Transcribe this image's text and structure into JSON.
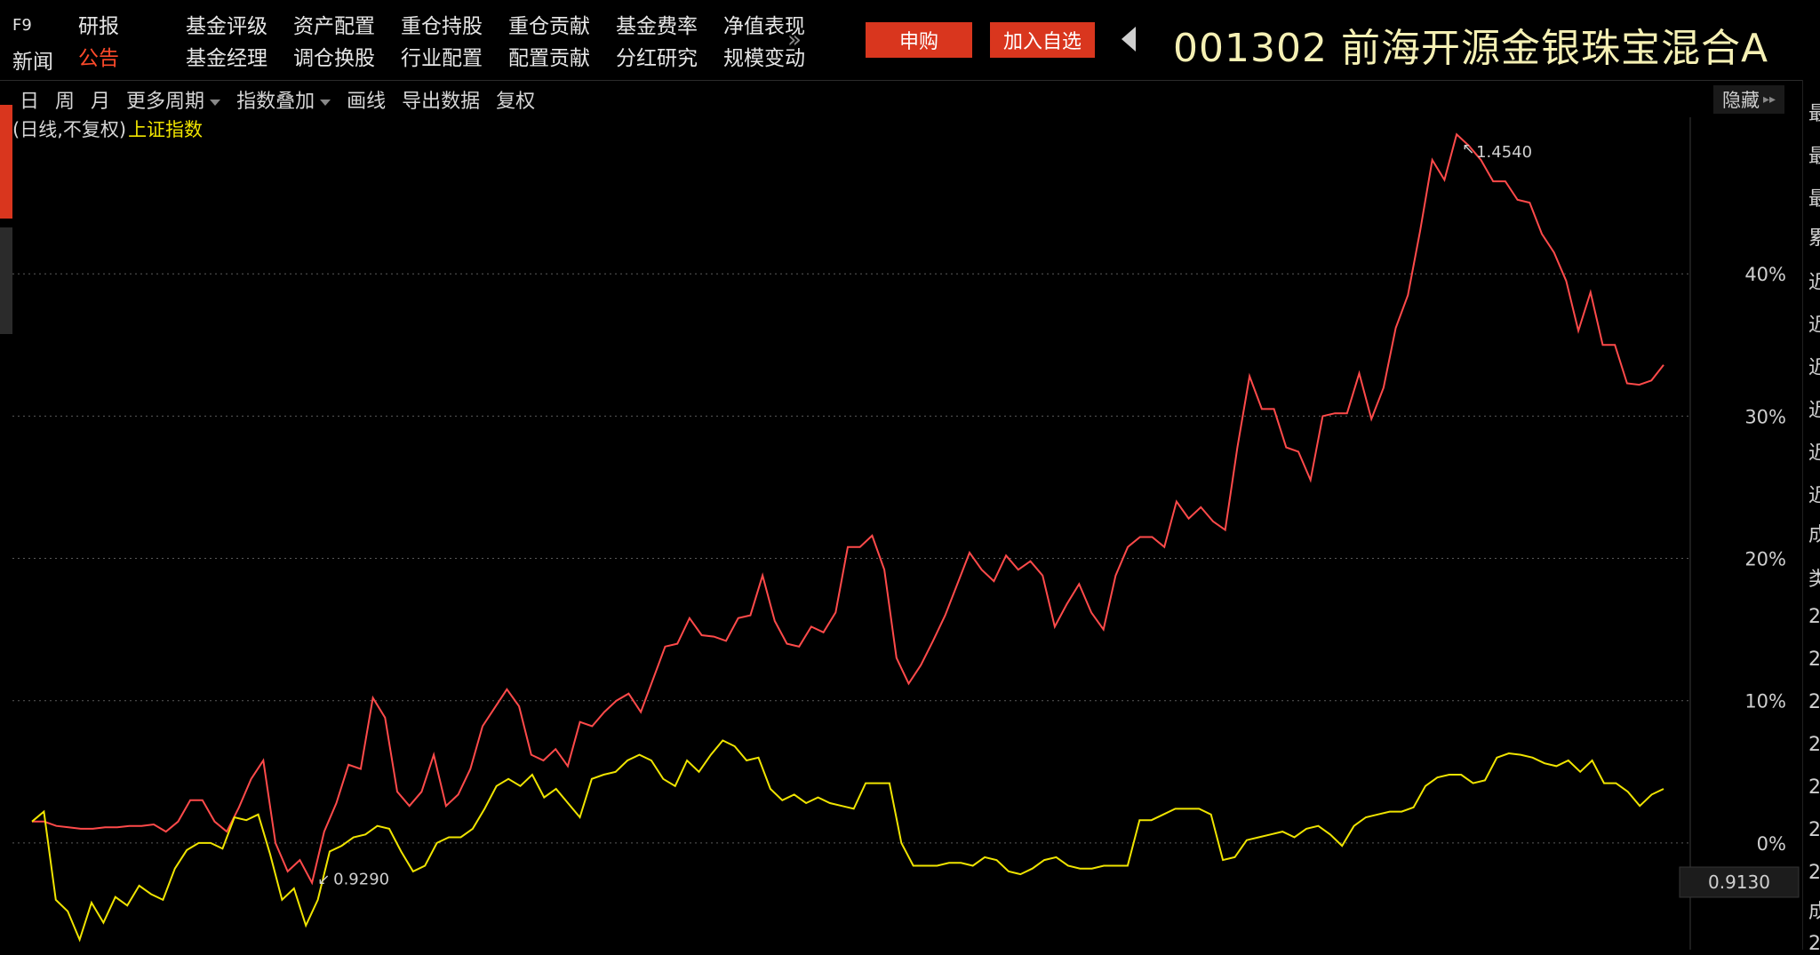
{
  "header": {
    "f9": "F9",
    "xinwen": "新闻",
    "nav": [
      {
        "label": "研报",
        "active": false
      },
      {
        "label": "基金评级",
        "active": false
      },
      {
        "label": "资产配置",
        "active": false
      },
      {
        "label": "重仓持股",
        "active": false
      },
      {
        "label": "重仓贡献",
        "active": false
      },
      {
        "label": "基金费率",
        "active": false
      },
      {
        "label": "净值表现",
        "active": false
      },
      {
        "label": "公告",
        "active": true
      },
      {
        "label": "基金经理",
        "active": false
      },
      {
        "label": "调仓换股",
        "active": false
      },
      {
        "label": "行业配置",
        "active": false
      },
      {
        "label": "配置贡献",
        "active": false
      },
      {
        "label": "分红研究",
        "active": false
      },
      {
        "label": "规模变动",
        "active": false
      }
    ],
    "more": "»",
    "buy_label": "申购",
    "watch_label": "加入自选",
    "fund_title": "001302 前海开源金银珠宝混合A"
  },
  "toolbar": {
    "items": [
      {
        "label": "日",
        "dropdown": false
      },
      {
        "label": "周",
        "dropdown": false
      },
      {
        "label": "月",
        "dropdown": false
      },
      {
        "label": "更多周期",
        "dropdown": true
      },
      {
        "label": "指数叠加",
        "dropdown": true
      },
      {
        "label": "画线",
        "dropdown": false
      },
      {
        "label": "导出数据",
        "dropdown": false
      },
      {
        "label": "复权",
        "dropdown": false
      }
    ],
    "hide_label": "隐藏"
  },
  "legend": {
    "prefix": "(日线,不复权)",
    "index_name": "上证指数"
  },
  "right_panel_chars": [
    "最",
    "最",
    "最",
    "累",
    "近",
    "近",
    "近",
    "近",
    "近",
    "近",
    "成",
    "类",
    "2",
    "2",
    "2",
    "2",
    "2",
    "2",
    "2",
    "成",
    "2"
  ],
  "colors": {
    "fund": "#ff4a4a",
    "index": "#f0e400",
    "grid": "#5a5a5a",
    "accent": "#d9361e"
  },
  "chart_data": {
    "type": "line",
    "y_unit": "%",
    "y_ticks": [
      "0%",
      "10%",
      "20%",
      "30%",
      "40%"
    ],
    "ylim": [
      -7.5,
      51
    ],
    "annotations": {
      "max_label": "1.4540",
      "min_label": "0.9290",
      "current_value": "0.9130"
    },
    "series": [
      {
        "name": "001302 前海开源金银珠宝混合A",
        "values": [
          1.5,
          1.5,
          1.2,
          1.1,
          1.0,
          1.0,
          1.1,
          1.1,
          1.2,
          1.2,
          1.3,
          0.8,
          1.5,
          3.0,
          3.0,
          1.5,
          0.8,
          2.5,
          4.5,
          5.8,
          0.0,
          -2.0,
          -1.2,
          -2.8,
          0.8,
          2.8,
          5.5,
          5.2,
          10.2,
          8.8,
          3.6,
          2.6,
          3.6,
          6.2,
          2.6,
          3.4,
          5.2,
          8.2,
          9.5,
          10.8,
          9.6,
          6.2,
          5.8,
          6.6,
          5.4,
          8.5,
          8.2,
          9.2,
          10.0,
          10.5,
          9.2,
          11.5,
          13.8,
          14.0,
          15.8,
          14.6,
          14.5,
          14.2,
          15.8,
          16.0,
          18.8,
          15.6,
          14.0,
          13.8,
          15.2,
          14.8,
          16.2,
          20.8,
          20.8,
          21.6,
          19.2,
          13.0,
          11.2,
          12.5,
          14.2,
          16.0,
          18.2,
          20.4,
          19.2,
          18.4,
          20.2,
          19.2,
          19.8,
          18.8,
          15.2,
          16.8,
          18.2,
          16.2,
          15.0,
          18.8,
          20.8,
          21.5,
          21.5,
          20.8,
          24.0,
          22.8,
          23.6,
          22.6,
          22.0,
          27.8,
          32.8,
          30.5,
          30.5,
          27.8,
          27.5,
          25.5,
          30.0,
          30.2,
          30.2,
          33.0,
          29.8,
          32.0,
          36.2,
          38.5,
          43.0,
          48.0,
          46.6,
          49.8,
          49.0,
          48.0,
          46.5,
          46.5,
          45.2,
          45.0,
          42.8,
          41.5,
          39.5,
          36.0,
          38.7,
          35.0,
          35.0,
          32.3,
          32.2,
          32.5,
          33.6
        ]
      },
      {
        "name": "上证指数",
        "values": [
          1.5,
          2.2,
          -4.0,
          -4.8,
          -6.8,
          -4.2,
          -5.6,
          -3.8,
          -4.4,
          -3.0,
          -3.6,
          -4.0,
          -1.8,
          -0.5,
          0.0,
          0.0,
          -0.4,
          1.8,
          1.6,
          2.0,
          -0.8,
          -4.0,
          -3.2,
          -5.8,
          -4.0,
          -0.6,
          -0.2,
          0.4,
          0.6,
          1.2,
          1.0,
          -0.6,
          -2.0,
          -1.6,
          0.0,
          0.4,
          0.4,
          1.0,
          2.4,
          4.0,
          4.5,
          4.0,
          4.8,
          3.2,
          3.8,
          2.8,
          1.8,
          4.5,
          4.8,
          5.0,
          5.8,
          6.2,
          5.8,
          4.5,
          4.0,
          5.8,
          5.0,
          6.2,
          7.2,
          6.8,
          5.8,
          6.0,
          3.8,
          3.0,
          3.4,
          2.8,
          3.2,
          2.8,
          2.6,
          2.4,
          4.2,
          4.2,
          4.2,
          0.0,
          -1.6,
          -1.6,
          -1.6,
          -1.4,
          -1.4,
          -1.6,
          -1.0,
          -1.2,
          -2.0,
          -2.2,
          -1.8,
          -1.2,
          -1.0,
          -1.6,
          -1.8,
          -1.8,
          -1.6,
          -1.6,
          -1.6,
          1.6,
          1.6,
          2.0,
          2.4,
          2.4,
          2.4,
          2.0,
          -1.2,
          -1.0,
          0.2,
          0.4,
          0.6,
          0.8,
          0.4,
          1.0,
          1.2,
          0.6,
          -0.2,
          1.2,
          1.8,
          2.0,
          2.2,
          2.2,
          2.5,
          4.0,
          4.6,
          4.8,
          4.8,
          4.2,
          4.4,
          6.0,
          6.3,
          6.2,
          6.0,
          5.6,
          5.4,
          5.8,
          5.0,
          5.8,
          4.2,
          4.2,
          3.6,
          2.6,
          3.4,
          3.8
        ]
      }
    ]
  }
}
